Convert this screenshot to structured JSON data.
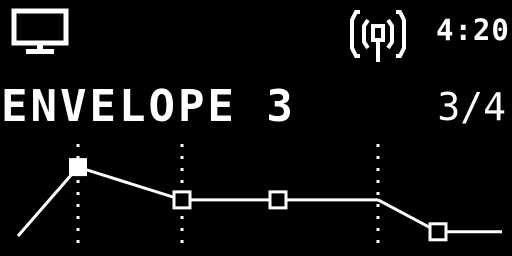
{
  "status_bar": {
    "device_icon": "monitor-icon",
    "connection_icon": "radio-signal-icon",
    "time": "4:20"
  },
  "header": {
    "title": "ENVELOPE 3",
    "page": "3/4"
  },
  "envelope": {
    "points": [
      {
        "time": 0,
        "level": 0
      },
      {
        "time": 60,
        "level": 0.82,
        "handle": "filled"
      },
      {
        "time": 164,
        "level": 0.43,
        "handle": "hollow"
      },
      {
        "time": 260,
        "level": 0.43,
        "handle": "hollow"
      },
      {
        "time": 360,
        "level": 0.43
      },
      {
        "time": 420,
        "level": 0.05,
        "handle": "hollow"
      },
      {
        "time": 484,
        "level": 0.05
      }
    ],
    "stage_markers": [
      60,
      164,
      360
    ],
    "colors": {
      "line": "#ffffff",
      "background": "#000000"
    }
  }
}
